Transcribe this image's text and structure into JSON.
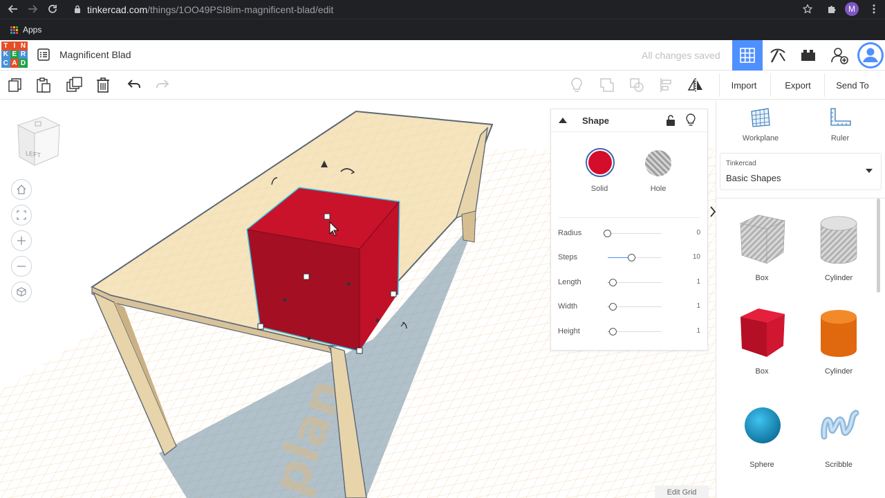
{
  "browser": {
    "url_host": "tinkercad.com",
    "url_path": "/things/1OO49PSI8im-magnificent-blad/edit",
    "bookmark_apps": "Apps",
    "profile_initial": "M"
  },
  "header": {
    "logo_letters": [
      "T",
      "I",
      "N",
      "K",
      "E",
      "R",
      "C",
      "A",
      "D"
    ],
    "logo_colors": [
      "#e54d26",
      "#e54d26",
      "#e54d26",
      "#4a90d9",
      "#1fa34a",
      "#4a90d9",
      "#4a90d9",
      "#e54d26",
      "#1fa34a"
    ],
    "design_title": "Magnificent Blad",
    "save_status": "All changes saved"
  },
  "toolbar": {
    "import_label": "Import",
    "export_label": "Export",
    "send_to_label": "Send To"
  },
  "workspace": {
    "viewcube_face": "LEFT",
    "edit_grid_label": "Edit Grid",
    "watermark_text": "plan"
  },
  "inspector": {
    "title": "Shape",
    "solid_label": "Solid",
    "hole_label": "Hole",
    "solid_color": "#d40d2a",
    "properties": [
      {
        "label": "Radius",
        "value": "0",
        "position": 0.0
      },
      {
        "label": "Steps",
        "value": "10",
        "position": 0.45
      },
      {
        "label": "Length",
        "value": "1",
        "position": 0.1
      },
      {
        "label": "Width",
        "value": "1",
        "position": 0.1
      },
      {
        "label": "Height",
        "value": "1",
        "position": 0.1
      }
    ]
  },
  "library": {
    "workplane_label": "Workplane",
    "ruler_label": "Ruler",
    "source_caption": "Tinkercad",
    "selected_collection": "Basic Shapes",
    "shapes": [
      {
        "name": "Box",
        "kind": "hole-box"
      },
      {
        "name": "Cylinder",
        "kind": "hole-cylinder"
      },
      {
        "name": "Box",
        "kind": "box"
      },
      {
        "name": "Cylinder",
        "kind": "cylinder"
      },
      {
        "name": "Sphere",
        "kind": "sphere"
      },
      {
        "name": "Scribble",
        "kind": "scribble"
      }
    ]
  },
  "colors": {
    "accent": "#4f90ff",
    "box_red": "#d40d2a",
    "cylinder_orange": "#e86a10",
    "sphere_blue": "#1692c9",
    "table_tan": "#f3dfb4"
  }
}
